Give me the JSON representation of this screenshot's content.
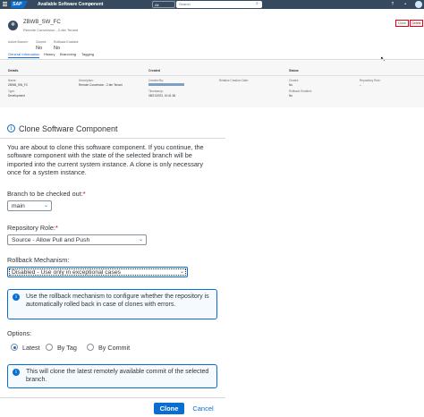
{
  "shell": {
    "logo": "SAP",
    "title": "Available Software Component",
    "scope": "All",
    "search_placeholder": "Search"
  },
  "header": {
    "title": "ZBWB_SW_FC",
    "subtitle": "Remote Conversion - 2-tier Tenant",
    "attributes": [
      {
        "label": "Active Branch:",
        "value": ""
      },
      {
        "label": "Cloned:",
        "value": "No"
      },
      {
        "label": "Rollback Enabled:",
        "value": "No"
      }
    ],
    "clone_label": "Clone",
    "delete_label": "Delete"
  },
  "tabs": [
    "General Information",
    "History",
    "Branching",
    "Tagging"
  ],
  "info": {
    "details_head": "Details",
    "created_head": "Created",
    "status_head": "Status",
    "fields": {
      "name_label": "Name:",
      "name_value": "ZBWB_SW_FC",
      "desc_label": "Description:",
      "desc_value": "Remote Conversion - 2-tier Tenant",
      "type_label": "Type:",
      "type_value": "Development",
      "createdby_label": "Created By:",
      "timestamp_label": "Timestamp:",
      "timestamp_value": "08/21/2023, 10:41:36",
      "relative_label": "Relative Creation Date:",
      "cloned_label": "Cloned:",
      "cloned_value": "No",
      "rollback_label": "Rollback Enabled:",
      "rollback_value": "No",
      "reporole_label": "Repository Role:",
      "reporole_value": "–"
    }
  },
  "dialog": {
    "title": "Clone Software Component",
    "intro": "You are about to clone this software component. If you continue, the software component with the state of the selected branch will be imported into the current system instance. A clone is only necessary once for a system instance.",
    "branch_label": "Branch to be checked out:",
    "branch_value": "main",
    "role_label": "Repository Role:",
    "role_value": "Source - Allow Pull and Push",
    "rollback_label": "Rollback Mechanism:",
    "rollback_value": "Disabled - Use only in exceptional cases",
    "rollback_info": "Use the rollback mechanism to configure whether the repository is automatically rolled back in case of clones with errors.",
    "options_label": "Options:",
    "options": [
      {
        "label": "Latest",
        "selected": true
      },
      {
        "label": "By Tag",
        "selected": false
      },
      {
        "label": "By Commit",
        "selected": false
      }
    ],
    "latest_info": "This will clone the latest remotely available commit of the selected branch.",
    "clone_button": "Clone",
    "cancel_button": "Cancel"
  },
  "colors": {
    "accent": "#0a6ed1",
    "shell": "#354a5f",
    "required": "#bb0000",
    "highlight": "#e9001b"
  }
}
